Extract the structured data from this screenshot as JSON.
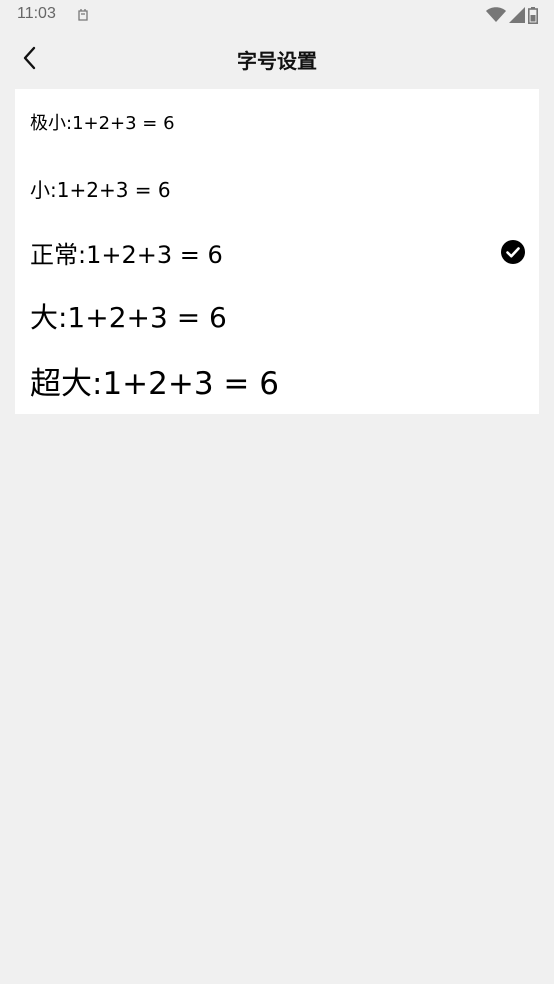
{
  "status_bar": {
    "time": "11:03",
    "icons": [
      "notification-icon",
      "wifi-icon",
      "cell-signal-icon",
      "battery-icon"
    ]
  },
  "header": {
    "title": "字号设置",
    "back_icon": "chevron-left-icon"
  },
  "font_size_options": [
    {
      "label": "极小:1+2+3 = 6",
      "selected": false
    },
    {
      "label": "小:1+2+3 = 6",
      "selected": false
    },
    {
      "label": "正常:1+2+3 = 6",
      "selected": true
    },
    {
      "label": "大:1+2+3 = 6",
      "selected": false
    },
    {
      "label": "超大:1+2+3 = 6",
      "selected": false
    }
  ],
  "selected_icon": "check-circle-icon",
  "colors": {
    "background": "#f0f0f0",
    "card": "#ffffff",
    "text": "#000000",
    "status_text": "#666666"
  }
}
